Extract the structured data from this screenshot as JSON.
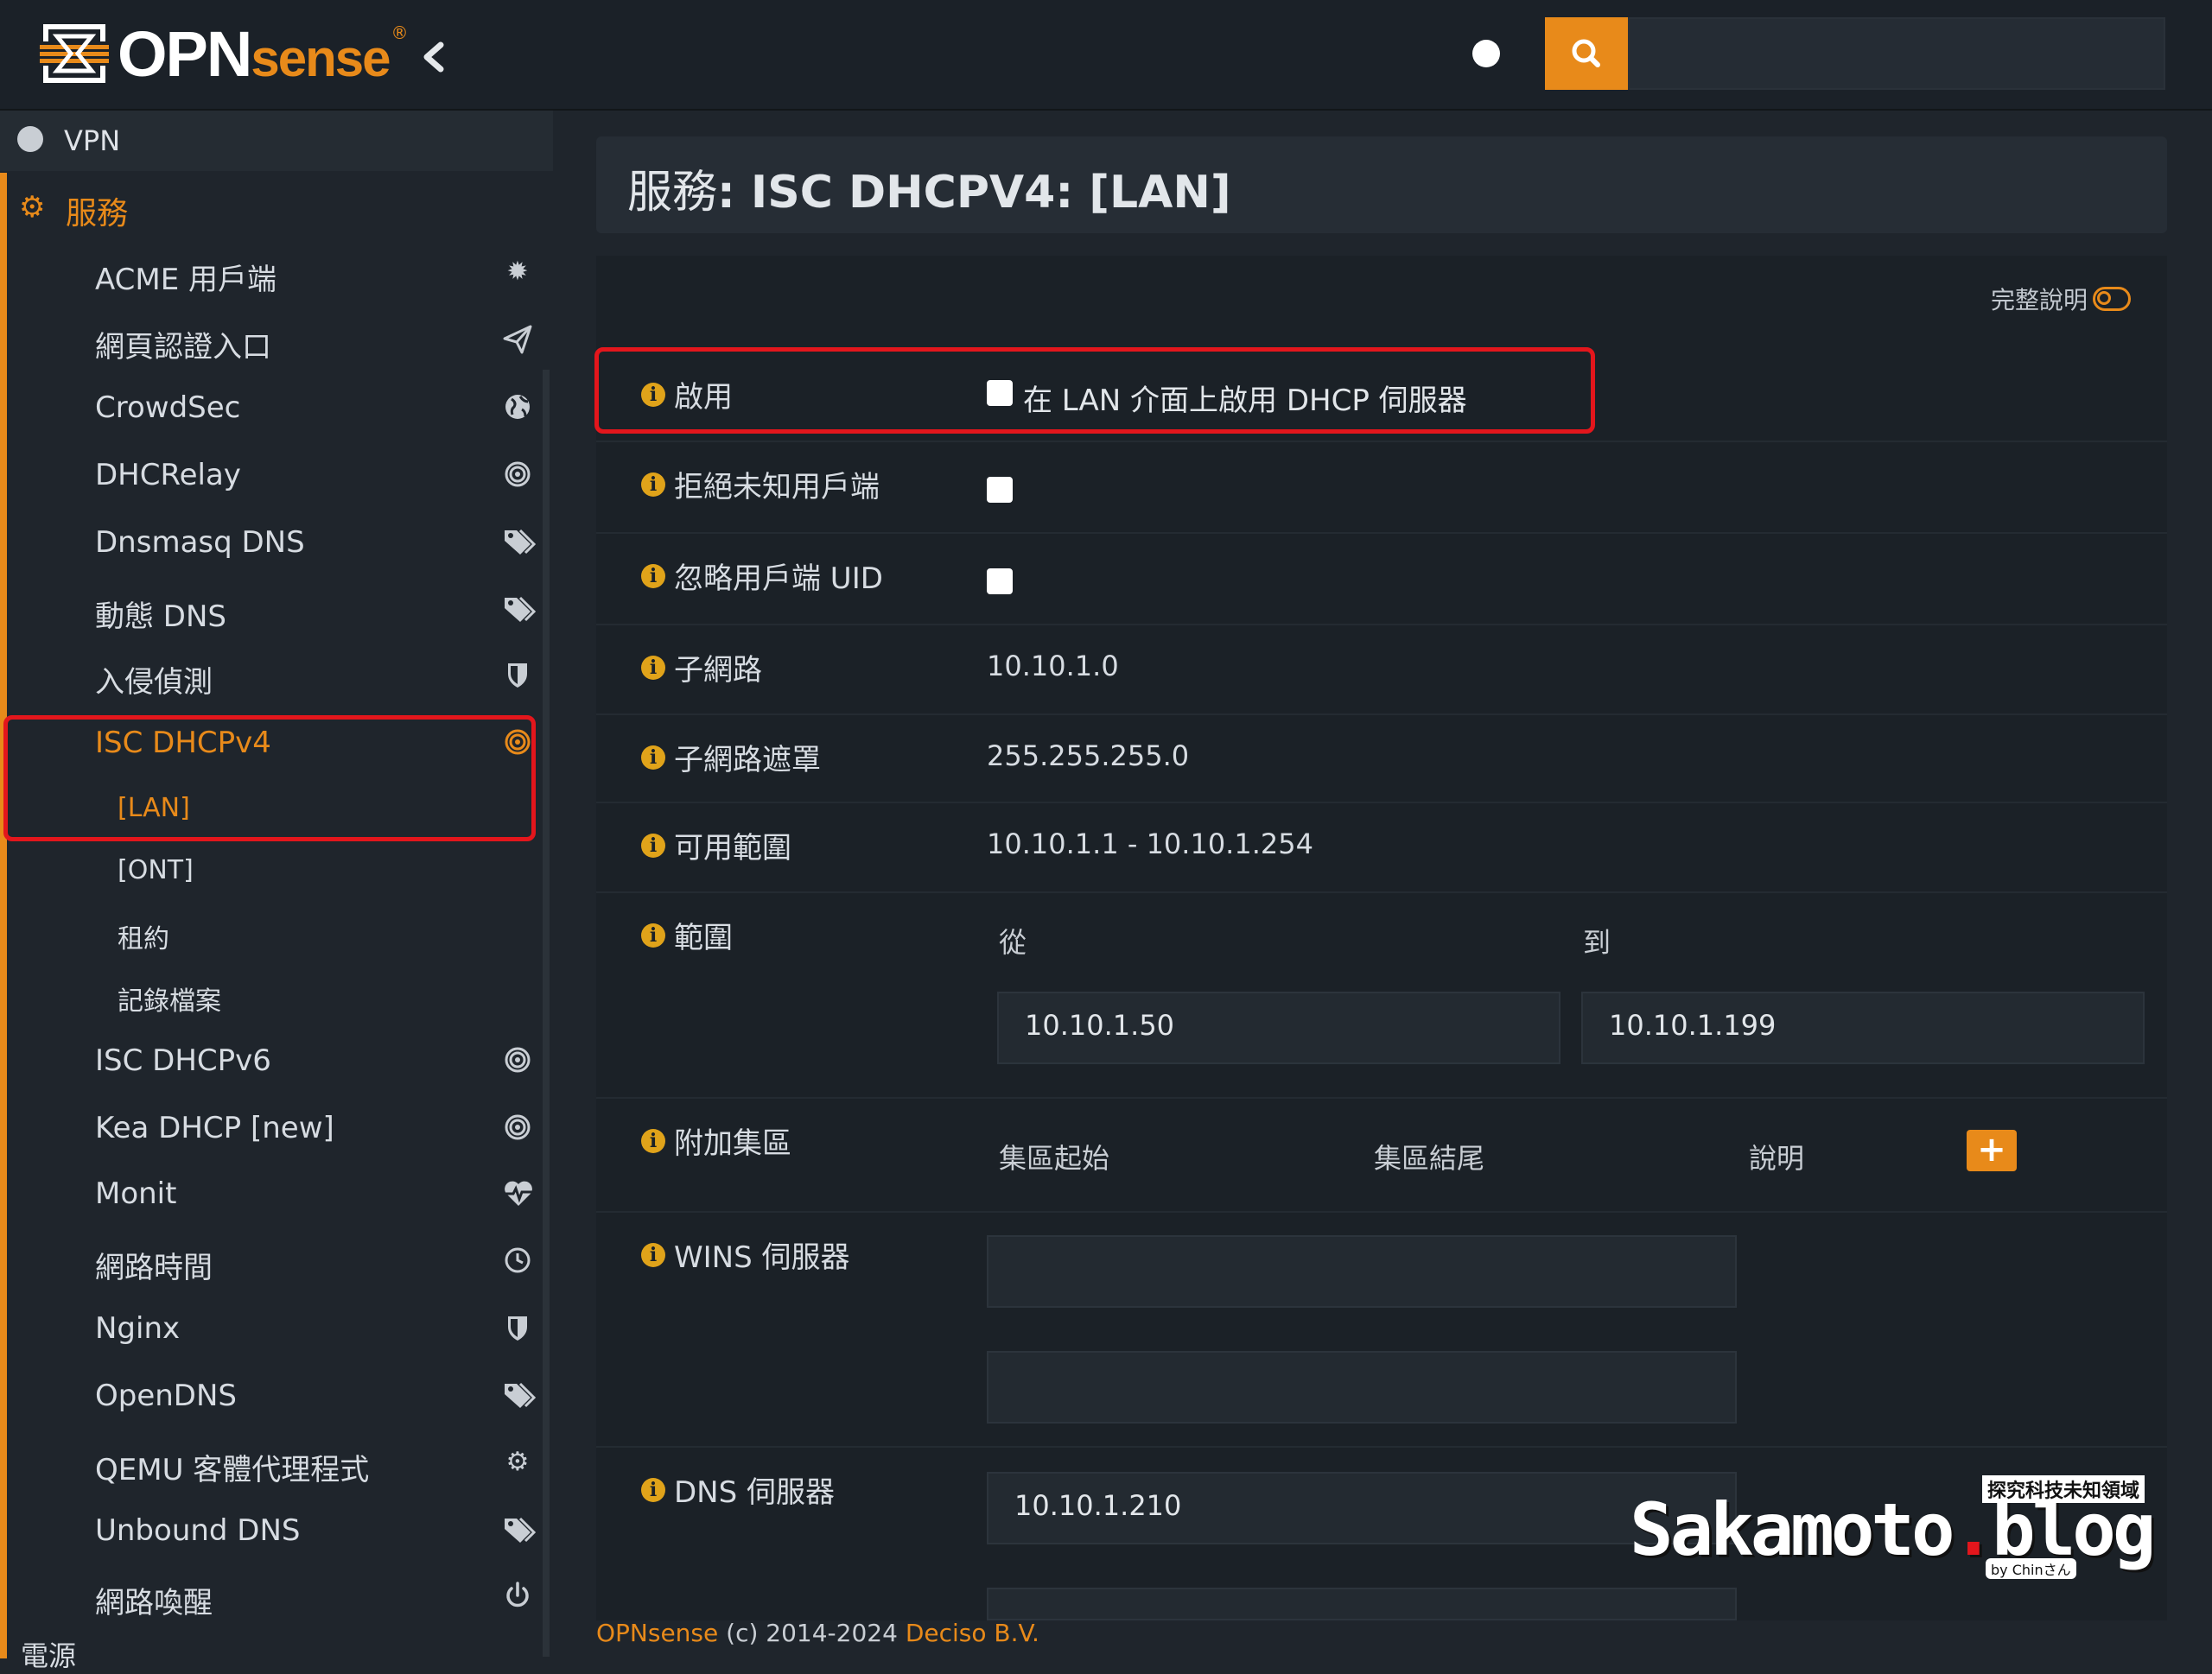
{
  "header": {
    "logo_main": "OPN",
    "logo_accent": "sense",
    "logo_reg": "®",
    "collapse_icon": "chevron-left-icon",
    "search_icon": "search-icon",
    "search_placeholder": "",
    "accent_color": "#e88a1a"
  },
  "sidebar": {
    "top_item": "VPN",
    "section": "服務",
    "items": [
      {
        "label": "ACME 用戶端",
        "icon": "gear-icon"
      },
      {
        "label": "網頁認證入口",
        "icon": "paper-plane-icon"
      },
      {
        "label": "CrowdSec",
        "icon": "globe-icon"
      },
      {
        "label": "DHCRelay",
        "icon": "bullseye-icon"
      },
      {
        "label": "Dnsmasq DNS",
        "icon": "tags-icon"
      },
      {
        "label": "動態 DNS",
        "icon": "tags-icon"
      },
      {
        "label": "入侵偵測",
        "icon": "shield-icon"
      },
      {
        "label": "ISC DHCPv4",
        "icon": "bullseye-icon"
      },
      {
        "label": "ISC DHCPv6",
        "icon": "bullseye-icon"
      },
      {
        "label": "Kea DHCP [new]",
        "icon": "bullseye-icon"
      },
      {
        "label": "Monit",
        "icon": "heartbeat-icon"
      },
      {
        "label": "網路時間",
        "icon": "clock-icon"
      },
      {
        "label": "Nginx",
        "icon": "shield-icon"
      },
      {
        "label": "OpenDNS",
        "icon": "tags-icon"
      },
      {
        "label": "QEMU 客體代理程式",
        "icon": "gear-icon"
      },
      {
        "label": "Unbound DNS",
        "icon": "tags-icon"
      },
      {
        "label": "網路喚醒",
        "icon": "power-icon"
      }
    ],
    "subitems": [
      "[LAN]",
      "[ONT]",
      "租約",
      "記錄檔案"
    ],
    "bottom_item": "電源"
  },
  "page": {
    "title_prefix": "服務",
    "title_main": ": ISC DHCPV4: [LAN]",
    "help_label": "完整說明"
  },
  "form": {
    "enable": {
      "label": "啟用",
      "text": "在 LAN 介面上啟用 DHCP 伺服器",
      "checked": false
    },
    "deny_unknown": {
      "label": "拒絕未知用戶端",
      "checked": false
    },
    "ignore_uid": {
      "label": "忽略用戶端 UID",
      "checked": false
    },
    "subnet": {
      "label": "子網路",
      "value": "10.10.1.0"
    },
    "subnet_mask": {
      "label": "子網路遮罩",
      "value": "255.255.255.0"
    },
    "available_range": {
      "label": "可用範圍",
      "value": "10.10.1.1 - 10.10.1.254"
    },
    "range": {
      "label": "範圍",
      "from_label": "從",
      "to_label": "到",
      "from": "10.10.1.50",
      "to": "10.10.1.199"
    },
    "pools": {
      "label": "附加集區",
      "col_start": "集區起始",
      "col_end": "集區結尾",
      "col_desc": "說明",
      "add_icon": "plus-icon"
    },
    "wins": {
      "label": "WINS 伺服器",
      "server1": "",
      "server2": ""
    },
    "dns": {
      "label": "DNS 伺服器",
      "server1": "10.10.1.210",
      "server2": ""
    }
  },
  "footer": {
    "brand": "OPNsense",
    "copy": " (c) 2014-2024 ",
    "company": "Deciso B.V."
  },
  "watermark": {
    "main": "Sakamoto",
    "dot": ".",
    "tld": "blog",
    "tagline": "探究科技未知領域",
    "by": "by Chinさん"
  }
}
